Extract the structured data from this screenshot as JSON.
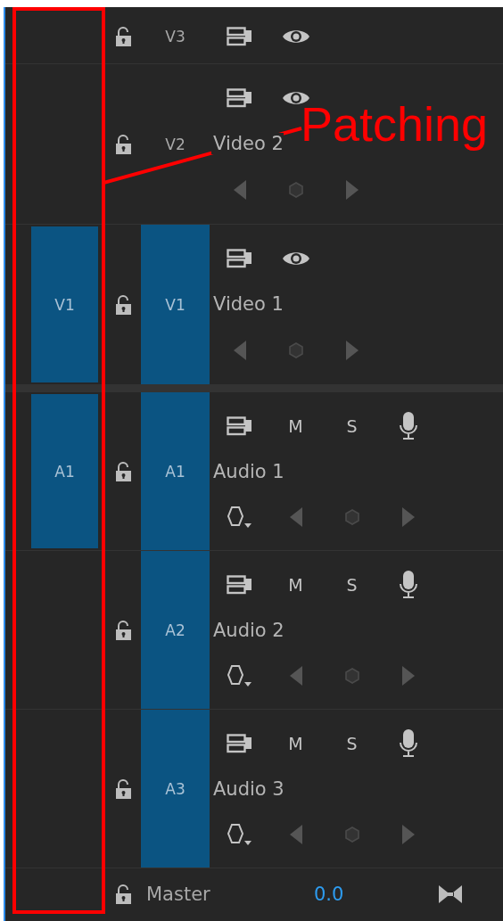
{
  "tracks": [
    {
      "kind": "video",
      "target": "V3",
      "targeted": false,
      "expanded": false
    },
    {
      "kind": "video",
      "target": "V2",
      "targeted": false,
      "expanded": true,
      "name": "Video 2"
    },
    {
      "kind": "video",
      "source": "V1",
      "target": "V1",
      "targeted": true,
      "expanded": true,
      "name": "Video 1"
    },
    {
      "kind": "audio",
      "source": "A1",
      "target": "A1",
      "targeted": true,
      "expanded": true,
      "name": "Audio 1",
      "mute": "M",
      "solo": "S"
    },
    {
      "kind": "audio",
      "target": "A2",
      "targeted": true,
      "expanded": true,
      "name": "Audio 2",
      "mute": "M",
      "solo": "S"
    },
    {
      "kind": "audio",
      "target": "A3",
      "targeted": true,
      "expanded": true,
      "name": "Audio 3",
      "mute": "M",
      "solo": "S"
    }
  ],
  "master": {
    "name": "Master",
    "value": "0.0"
  },
  "annotation": {
    "label": "Patching"
  }
}
